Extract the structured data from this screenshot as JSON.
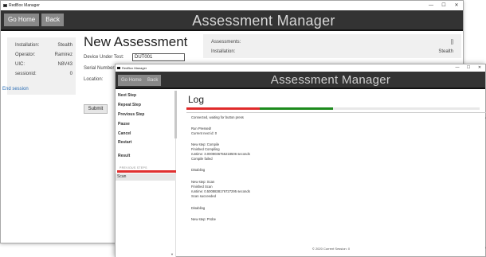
{
  "back_window": {
    "titlebar_title": "RedBox Manager",
    "window_controls": [
      "—",
      "☐",
      "✕"
    ],
    "header": {
      "go_home_label": "Go Home",
      "back_label": "Back",
      "title": "Assessment Manager"
    },
    "info_panel": [
      {
        "label": "Installation:",
        "value": "Stealth"
      },
      {
        "label": "Operator:",
        "value": "Ramirez"
      },
      {
        "label": "UIC:",
        "value": "N8V43"
      },
      {
        "label": "sessionid:",
        "value": "0"
      }
    ],
    "end_session_label": "End session",
    "new_assessment": {
      "title": "New Assessment",
      "device_under_test_label": "Device Under Test:",
      "device_under_test_value": "DUT001",
      "serial_number_label": "Serial Number:",
      "location_label": "Location:",
      "submit_label": "Submit"
    },
    "assessments_panel": [
      {
        "label": "Assessments:",
        "value": "[]"
      },
      {
        "label": "Installation:",
        "value": "Stealth"
      }
    ]
  },
  "front_window": {
    "titlebar_title": "RedBox Manager",
    "window_controls": [
      "—",
      "☐",
      "✕"
    ],
    "header": {
      "go_home_label": "Go Home",
      "back_label": "Back",
      "title": "Assessment Manager"
    },
    "sidebar": {
      "actions": [
        "Next Step",
        "Repeat Step",
        "Previous Step",
        "Pause",
        "Cancel",
        "Restart",
        "Result"
      ],
      "previous_steps_label": "PREVIOUS STEPS",
      "previous_steps": [
        "Scan"
      ]
    },
    "log": {
      "title": "Log",
      "progress": {
        "red_fraction": 0.25,
        "green_fraction": 0.25,
        "red_color": "#e02a2a",
        "green_color": "#1c8a1c"
      },
      "lines": [
        "Connected, waiting for button press",
        "Run Pressed!",
        "Current next id: 0",
        "New step: Compile",
        "Finished Compiling",
        "runtime: 3.0009036755218506 seconds",
        "Compile failed",
        "Disabling",
        "New step: Scan",
        "Finished Scan",
        "runtime: 0.5008838176727295 seconds",
        "Scan succeeded",
        "Disabling",
        "New step: Probe"
      ],
      "footer": "© 2020 Current Session: 0"
    }
  }
}
